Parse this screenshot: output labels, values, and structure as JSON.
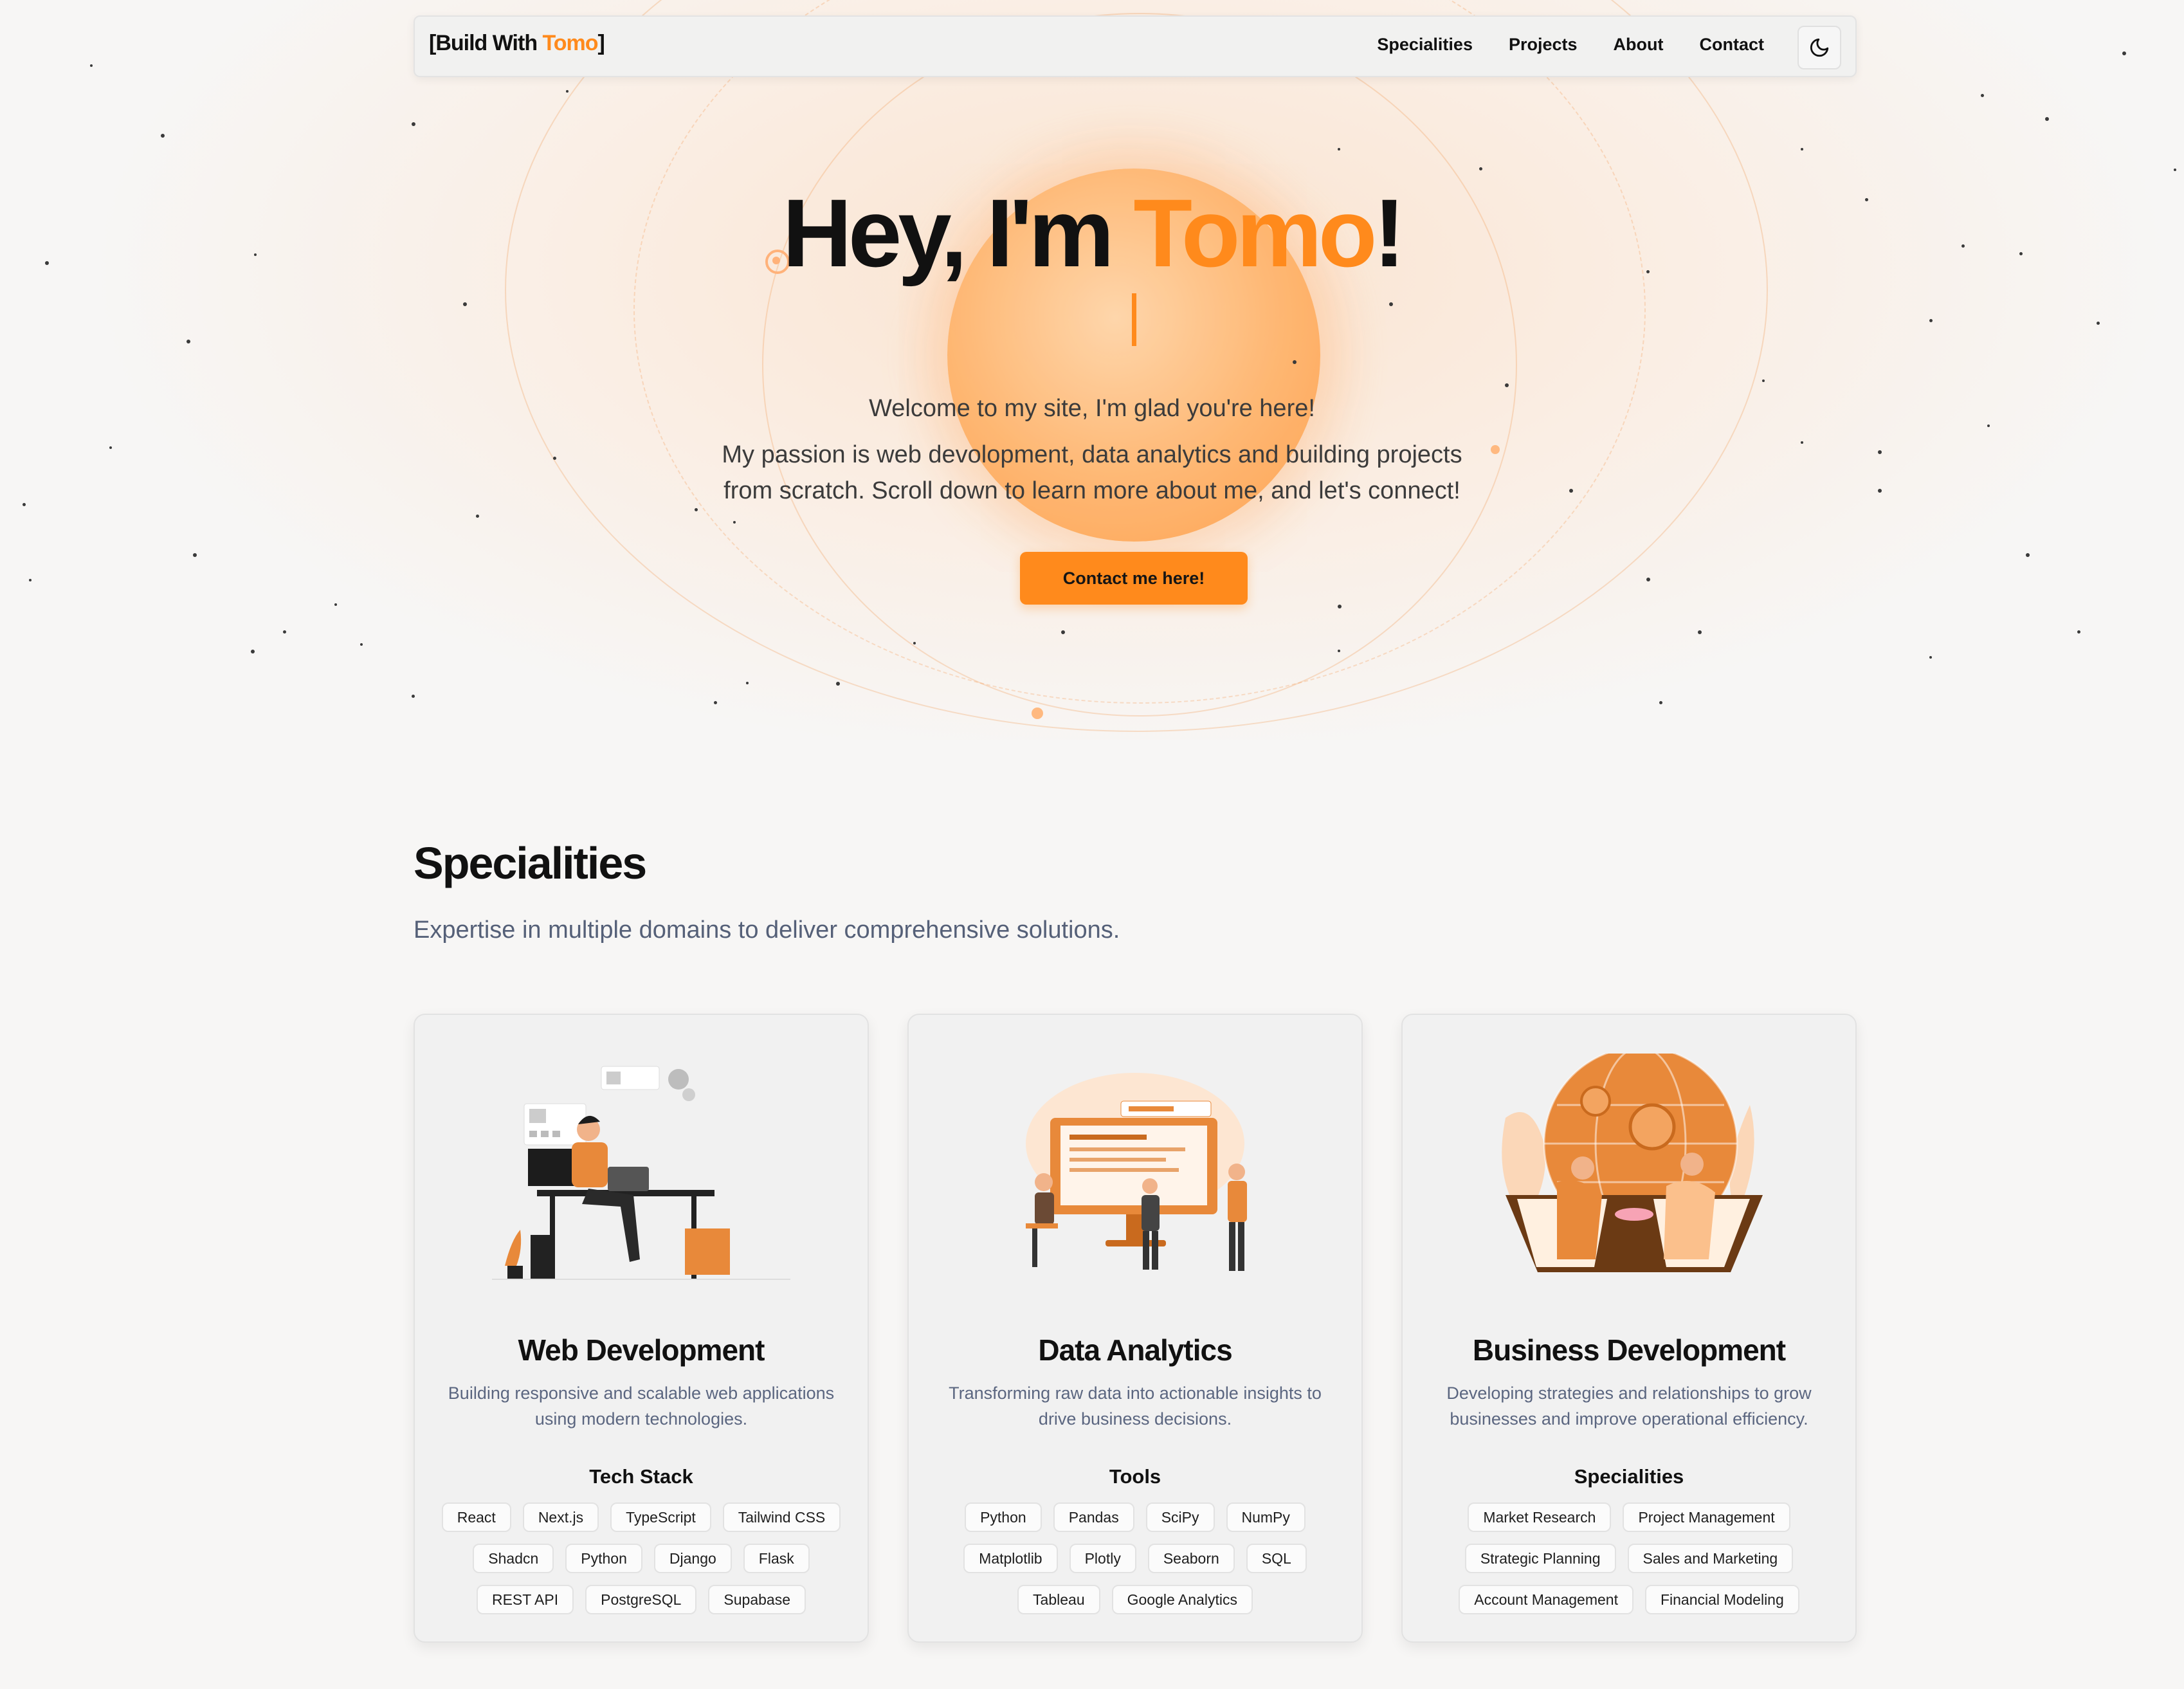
{
  "brand": {
    "prefix": "[Build With ",
    "accent": "Tomo",
    "suffix": "]"
  },
  "nav": {
    "links": [
      "Specialities",
      "Projects",
      "About",
      "Contact"
    ],
    "theme_icon": "moon-icon"
  },
  "hero": {
    "title_prefix": "Hey, I'm ",
    "title_accent": "Tomo",
    "title_suffix": "!",
    "line1": "Welcome to my site, I'm glad you're here!",
    "line2": "My passion is web devolopment, data analytics and building projects",
    "line3": "from scratch. Scroll down to learn more about me, and let's connect!",
    "cta": "Contact me here!"
  },
  "specialities": {
    "title": "Specialities",
    "subtitle": "Expertise in multiple domains to deliver comprehensive solutions.",
    "cards": [
      {
        "title": "Web Development",
        "desc": "Building responsive and scalable web applications using modern technologies.",
        "tags_title": "Tech Stack",
        "tags": [
          "React",
          "Next.js",
          "TypeScript",
          "Tailwind CSS",
          "Shadcn",
          "Python",
          "Django",
          "Flask",
          "REST API",
          "PostgreSQL",
          "Supabase"
        ],
        "icon": "developer-at-desk-illustration"
      },
      {
        "title": "Data Analytics",
        "desc": "Transforming raw data into actionable insights to drive business decisions.",
        "tags_title": "Tools",
        "tags": [
          "Python",
          "Pandas",
          "SciPy",
          "NumPy",
          "Matplotlib",
          "Plotly",
          "Seaborn",
          "SQL",
          "Tableau",
          "Google Analytics"
        ],
        "icon": "data-dashboard-illustration"
      },
      {
        "title": "Business Development",
        "desc": "Developing strategies and relationships to grow businesses and improve operational efficiency.",
        "tags_title": "Specialities",
        "tags": [
          "Market Research",
          "Project Management",
          "Strategic Planning",
          "Sales and Marketing",
          "Account Management",
          "Financial Modeling"
        ],
        "icon": "global-handshake-illustration"
      }
    ]
  },
  "colors": {
    "accent": "#ff8a1c",
    "text": "#111111",
    "muted": "#556078",
    "bg": "#f7f6f5"
  }
}
